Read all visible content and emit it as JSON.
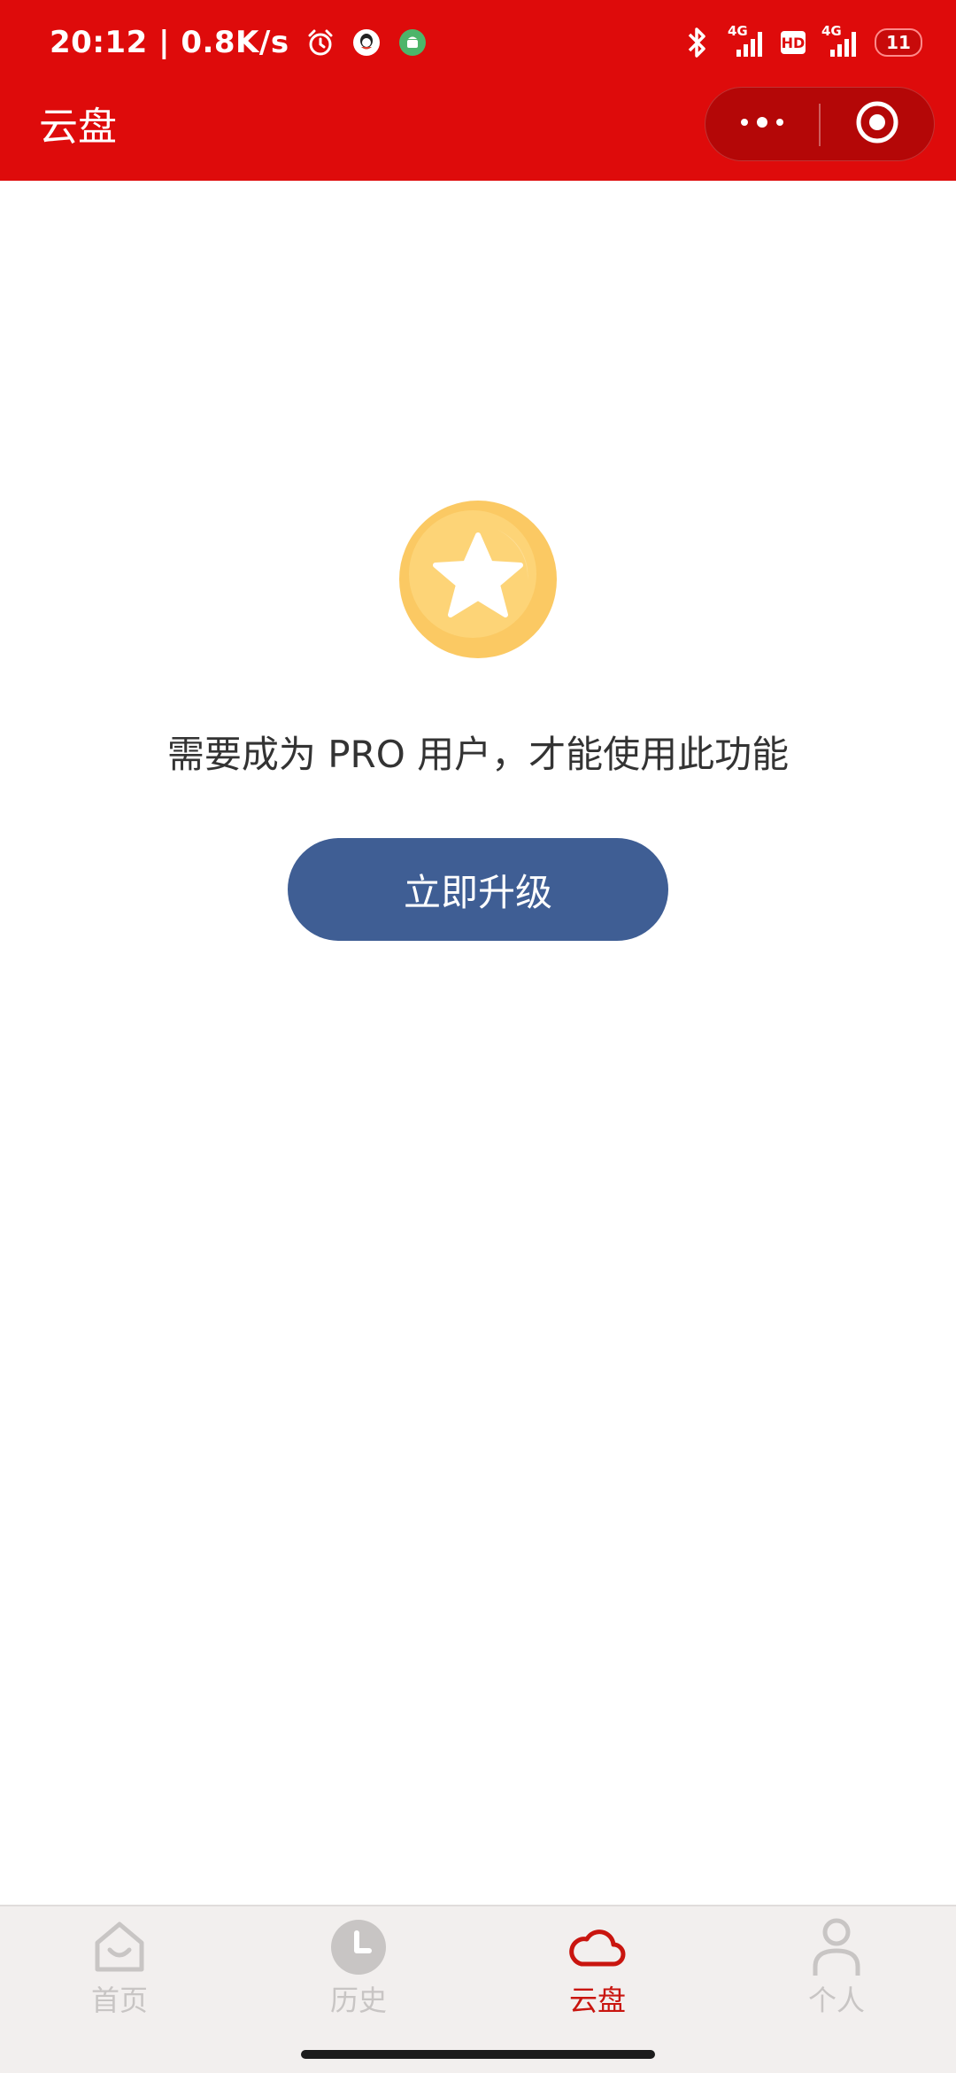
{
  "status_bar": {
    "time_speed": "20:12 | 0.8K/s",
    "network_1": "4G",
    "hd": "HD",
    "network_2": "4G",
    "battery": "11",
    "icons": [
      "alarm-icon",
      "qq-icon",
      "android-notification-icon",
      "bluetooth-icon",
      "signal-icon",
      "signal-icon"
    ]
  },
  "header": {
    "title": "云盘",
    "background_color": "#de0b0b",
    "more_icon": "more-dots-icon",
    "close_icon": "target-close-icon"
  },
  "main": {
    "badge_icon": "pro-star-badge-icon",
    "notice": "需要成为 PRO 用户，才能使用此功能",
    "upgrade_button": "立即升级",
    "button_color": "#3f5e94"
  },
  "tabbar": {
    "active_color": "#c9150f",
    "inactive_color": "#c8c5c4",
    "tabs": [
      {
        "label": "首页",
        "icon": "home-icon",
        "active": false
      },
      {
        "label": "历史",
        "icon": "clock-icon",
        "active": false
      },
      {
        "label": "云盘",
        "icon": "cloud-icon",
        "active": true
      },
      {
        "label": "个人",
        "icon": "person-icon",
        "active": false
      }
    ]
  }
}
